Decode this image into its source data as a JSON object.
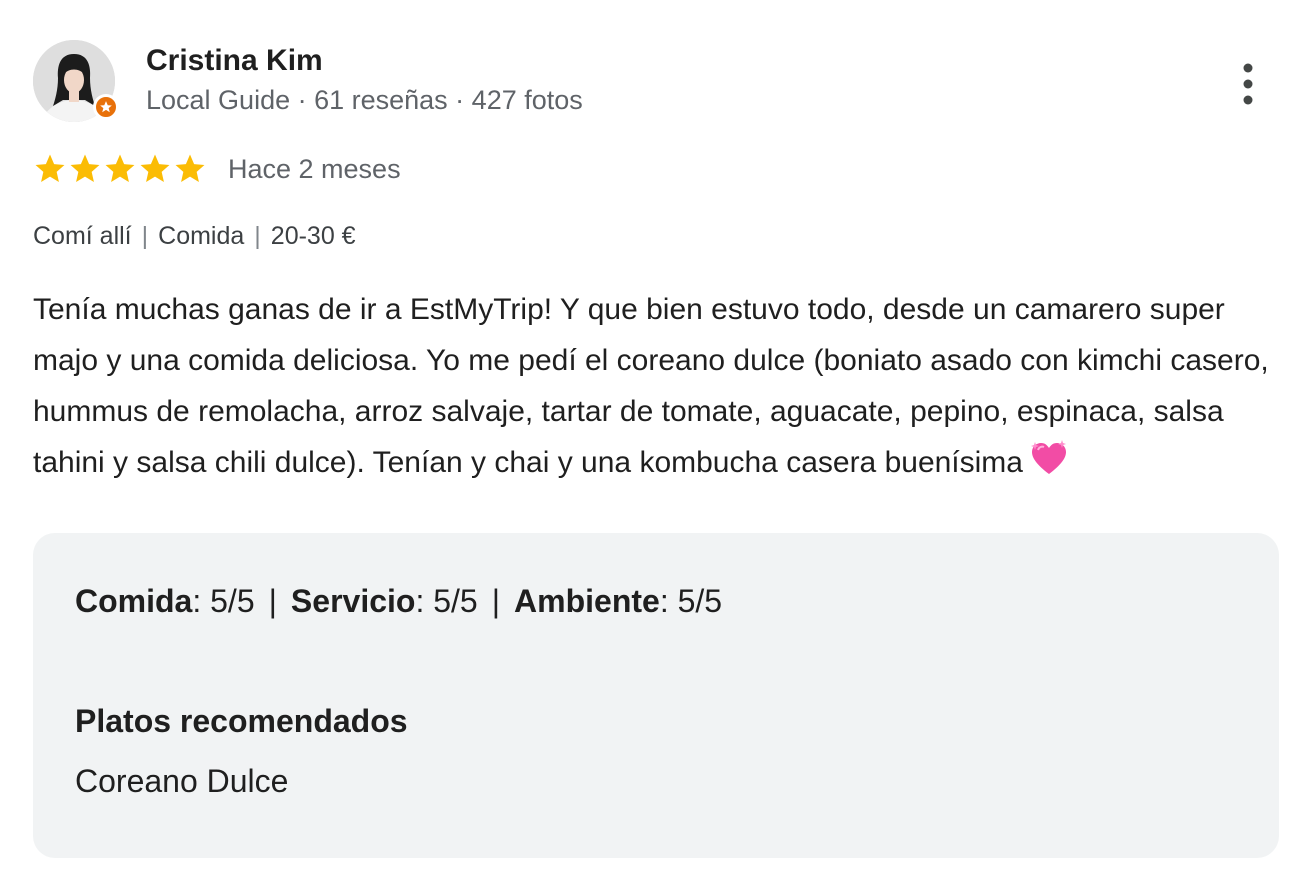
{
  "author": {
    "name": "Cristina Kim",
    "meta": "Local Guide · 61 reseñas · 427 fotos",
    "avatar_icon": "profile-photo",
    "badge_icon": "local-guide-star-badge",
    "badge_color": "#e8710a"
  },
  "menu": {
    "icon": "more-vert-icon"
  },
  "rating": {
    "stars": 5,
    "max_stars": 5,
    "star_color": "#fbbc04",
    "date": "Hace 2 meses"
  },
  "attributes": {
    "service_type": "Comí allí",
    "meal_type": "Comida",
    "price": "20-30 €",
    "separator": "|"
  },
  "review": {
    "text": "Tenía muchas ganas de ir a EstMyTrip! Y que bien estuvo todo, desde un camarero super majo y una comida deliciosa. Yo me pedí el coreano dulce (boniato asado con kimchi casero, hummus de remolacha, arroz salvaje, tartar de tomate, aguacate, pepino, espinaca, salsa tahini y salsa chili dulce). Tenían y chai y una kombucha casera buenísima",
    "emoji": "heart-with-sparkles"
  },
  "summary": {
    "food_label": "Comida",
    "food_value": ": 5/5",
    "service_label": "Servicio",
    "service_value": ": 5/5",
    "ambience_label": "Ambiente",
    "ambience_value": ": 5/5",
    "pipe": "|",
    "recommended_title": "Platos recomendados",
    "recommended_dish": "Coreano Dulce"
  }
}
